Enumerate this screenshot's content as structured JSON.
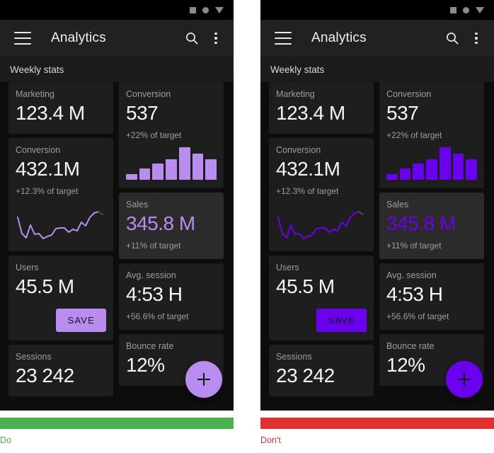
{
  "colors": {
    "do_bar": "#4caf50",
    "dont_bar": "#e03131",
    "accent_left": "#b98cf0",
    "accent_right": "#6a00ee",
    "surface": "#1e1e1e",
    "surface_selected": "#2b2b2b",
    "appbar": "#212121",
    "background": "#0d0d0d"
  },
  "statusbar": {
    "icons": [
      "square-icon",
      "circle-icon",
      "triangle-down-icon"
    ]
  },
  "appbar": {
    "menu_icon": "hamburger-menu-icon",
    "title": "Analytics",
    "search_icon": "search-icon",
    "overflow_icon": "more-vertical-icon"
  },
  "section": {
    "title": "Weekly stats"
  },
  "cards": {
    "marketing": {
      "label": "Marketing",
      "value": "123.4 M"
    },
    "conversion_left": {
      "label": "Conversion",
      "value": "432.1M",
      "sub": "+12.3% of target"
    },
    "users": {
      "label": "Users",
      "value": "45.5 M",
      "save_label": "SAVE"
    },
    "sessions": {
      "label": "Sessions",
      "value": "23 242"
    },
    "conversion_right": {
      "label": "Conversion",
      "value": "537",
      "sub": "+22% of target"
    },
    "sales": {
      "label": "Sales",
      "value": "345.8 M",
      "sub": "+11% of target"
    },
    "avg_session": {
      "label": "Avg. session",
      "value": "4:53 H",
      "sub": "+56.6% of target"
    },
    "bounce_rate": {
      "label": "Bounce rate",
      "value": "12%"
    }
  },
  "fab": {
    "icon": "plus-icon"
  },
  "verdicts": {
    "do": {
      "label": "Do"
    },
    "dont": {
      "label": "Don't"
    }
  },
  "chart_data": [
    {
      "type": "bar",
      "title": "Conversion weekly bars",
      "categories": [
        "1",
        "2",
        "3",
        "4",
        "5",
        "6",
        "7"
      ],
      "values": [
        18,
        34,
        50,
        64,
        100,
        80,
        62
      ],
      "xlabel": "",
      "ylabel": "",
      "ylim": [
        0,
        100
      ]
    },
    {
      "type": "line",
      "title": "Conversion trend sparkline",
      "x": [
        0,
        1,
        2,
        3,
        4,
        5,
        6,
        7,
        8,
        9,
        10,
        11,
        12,
        13,
        14,
        15,
        16,
        17,
        18,
        19,
        20
      ],
      "values": [
        62,
        22,
        12,
        44,
        18,
        20,
        8,
        14,
        18,
        36,
        38,
        38,
        26,
        34,
        30,
        54,
        44,
        62,
        72,
        76,
        70
      ],
      "xlabel": "",
      "ylabel": "",
      "ylim": [
        0,
        100
      ]
    }
  ]
}
